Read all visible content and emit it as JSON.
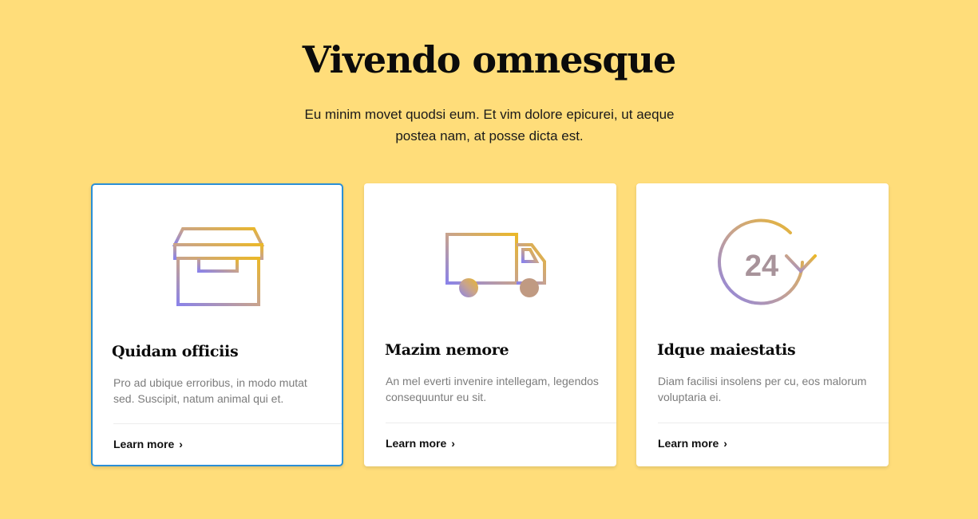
{
  "header": {
    "title": "Vivendo omnesque",
    "subtitle": "Eu minim movet quodsi eum. Et vim dolore epicurei, ut aeque postea nam, at posse dicta est."
  },
  "cards": [
    {
      "icon": "box-icon",
      "title": "Quidam officiis",
      "description": "Pro ad ubique erroribus, in modo mutat sed. Suscipit, natum animal qui et.",
      "link": "Learn more"
    },
    {
      "icon": "delivery-truck-icon",
      "title": "Mazim nemore",
      "description": "An mel everti invenire intellegam, legendos consequuntur eu sit.",
      "link": "Learn more"
    },
    {
      "icon": "24-hours-icon",
      "icon_text": "24",
      "title": "Idque maiestatis",
      "description": "Diam facilisi insolens per cu, eos malorum voluptaria ei.",
      "link": "Learn more"
    }
  ],
  "colors": {
    "background": "#FFDD7A",
    "selected_border": "#2B8FD6",
    "icon_gradient_start": "#8B83E8",
    "icon_gradient_end": "#E8B52A"
  }
}
